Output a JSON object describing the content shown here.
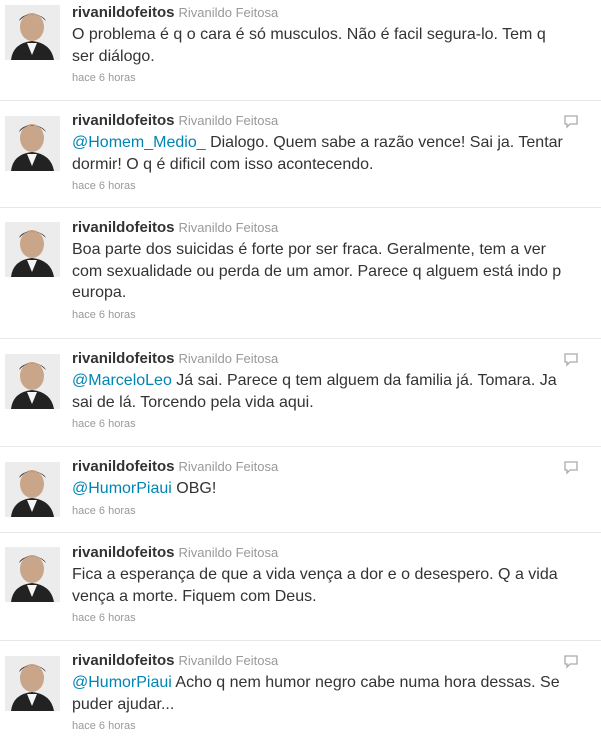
{
  "tweets": [
    {
      "screen_name": "rivanildofeitos",
      "full_name": "Rivanildo Feitosa",
      "mention": "",
      "text": "O problema é q o cara é só musculos. Não é facil segura-lo. Tem q ser diálogo.",
      "time": "hace 6 horas",
      "has_reply_icon": false
    },
    {
      "screen_name": "rivanildofeitos",
      "full_name": "Rivanildo Feitosa",
      "mention": "@Homem_Medio_",
      "text": " Dialogo. Quem sabe a razão vence! Sai ja. Tentar dormir! O q é dificil com isso acontecendo.",
      "time": "hace 6 horas",
      "has_reply_icon": true
    },
    {
      "screen_name": "rivanildofeitos",
      "full_name": "Rivanildo Feitosa",
      "mention": "",
      "text": "Boa parte dos suicidas é forte por ser fraca. Geralmente, tem a ver com sexualidade ou perda de um amor. Parece q alguem está indo p europa.",
      "time": "hace 6 horas",
      "has_reply_icon": false
    },
    {
      "screen_name": "rivanildofeitos",
      "full_name": "Rivanildo Feitosa",
      "mention": "@MarceloLeo",
      "text": " Já sai. Parece q tem alguem da familia já. Tomara. Ja sai de lá. Torcendo pela vida aqui.",
      "time": "hace 6 horas",
      "has_reply_icon": true
    },
    {
      "screen_name": "rivanildofeitos",
      "full_name": "Rivanildo Feitosa",
      "mention": "@HumorPiaui",
      "text": " OBG!",
      "time": "hace 6 horas",
      "has_reply_icon": true
    },
    {
      "screen_name": "rivanildofeitos",
      "full_name": "Rivanildo Feitosa",
      "mention": "",
      "text": "Fica a esperança de que a vida vença a dor e o desespero. Q a vida vença a morte. Fiquem com Deus.",
      "time": "hace 6 horas",
      "has_reply_icon": false
    },
    {
      "screen_name": "rivanildofeitos",
      "full_name": "Rivanildo Feitosa",
      "mention": "@HumorPiaui",
      "text": " Acho q nem humor negro cabe numa hora dessas. Se puder ajudar...",
      "time": "hace 6 horas",
      "has_reply_icon": true
    }
  ],
  "colors": {
    "mention": "#0084b4",
    "meta": "#999999",
    "text": "#333333"
  },
  "icons": {
    "avatar": "user-avatar-photo",
    "reply": "reply-icon"
  }
}
